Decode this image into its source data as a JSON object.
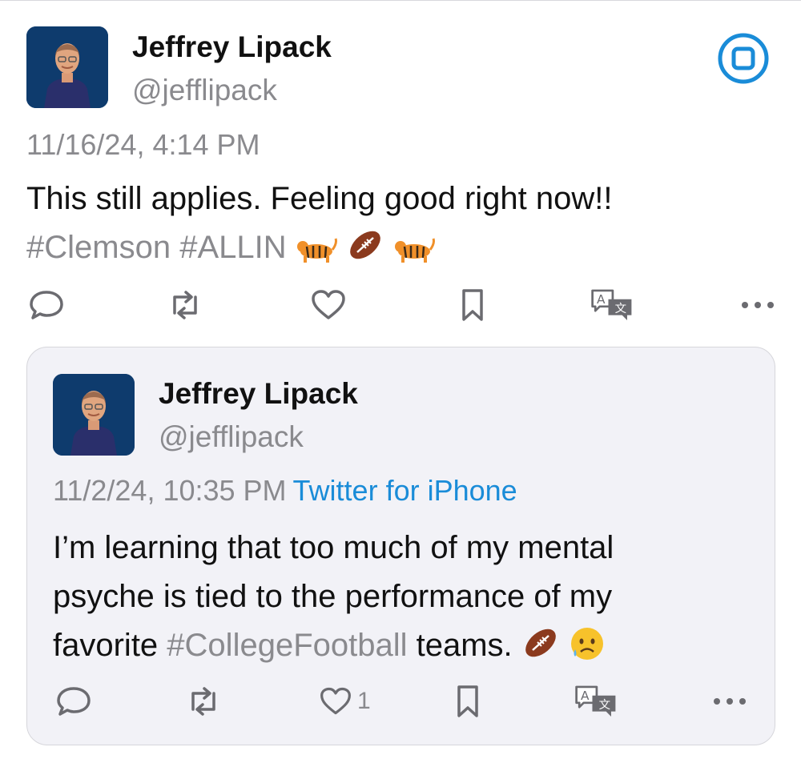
{
  "post": {
    "author_name": "Jeffrey Lipack",
    "author_handle": "@jefflipack",
    "timestamp": "11/16/24, 4:14 PM",
    "text_line1": "This still applies. Feeling good right now!!",
    "hashtags": "#Clemson #ALLIN",
    "emojis": [
      "tiger",
      "football",
      "tiger"
    ],
    "actions": [
      "reply-icon",
      "retweet-icon",
      "like-icon",
      "bookmark-icon",
      "translate-icon",
      "more-icon"
    ]
  },
  "quoted": {
    "author_name": "Jeffrey Lipack",
    "author_handle": "@jefflipack",
    "timestamp": "11/2/24, 10:35 PM",
    "source": "Twitter for iPhone",
    "text_line1": "I’m learning that too much of my mental",
    "text_line2": "psyche is tied to the performance of my",
    "text_line3_pre": "favorite",
    "hashtag": "#CollegeFootball",
    "text_line3_post": "teams.",
    "emojis": [
      "football",
      "sad-relieved-face"
    ],
    "like_count": "1"
  },
  "colors": {
    "accent": "#1a8cd8",
    "muted": "#8a8a8e",
    "card_bg": "#f2f2f7"
  }
}
